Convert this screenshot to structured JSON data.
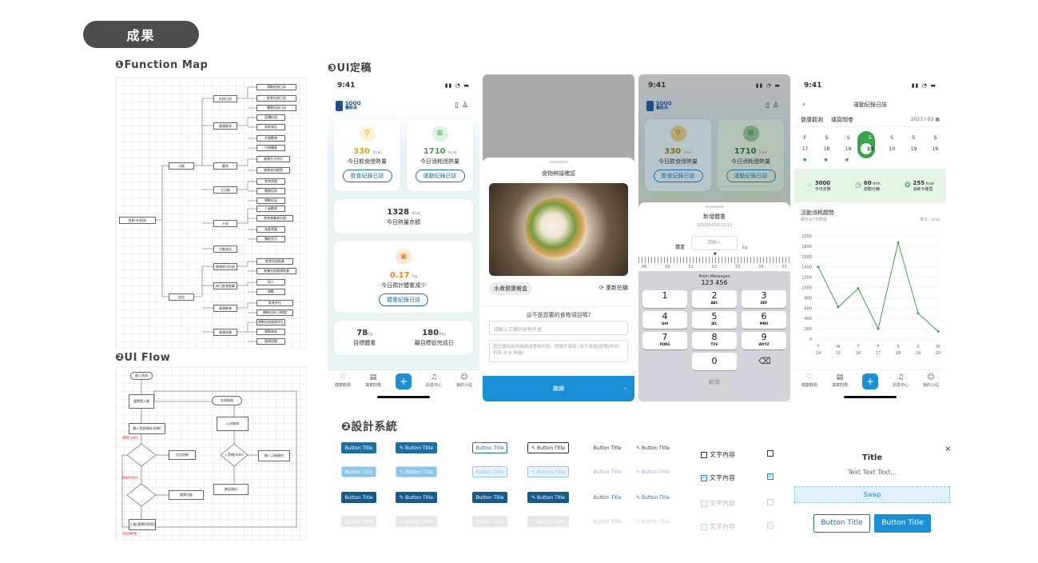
{
  "header_pill": "成果",
  "sections": {
    "function_map": "❶Function Map",
    "ui_flow": "❷UI Flow",
    "ui_final": "❸UI定稿",
    "design_system": "❷設計系統"
  },
  "fm": {
    "root": "首頁(未登錄)",
    "l1": [
      "功能",
      "設定"
    ],
    "l2": [
      "紀錄日誌",
      "健康觀測",
      "簡易",
      "主功能",
      "分享",
      "活動資訊",
      "健康狀況紀錄",
      "每日飲食推薦",
      "健康數據",
      "健康提醒"
    ],
    "l3": [
      "運動紀錄日誌",
      "飲食紀錄日誌",
      "體重紀錄日誌",
      "身體紀錄",
      "調查報告",
      "步驟數據",
      "目標體重",
      "健康生活評估",
      "健康資訊觀察",
      "食物辨識",
      "體重紀錄",
      "運動紀錄",
      "人員數據",
      "食物營養資料檔",
      "減重建議",
      "體能狀況",
      "飲食紀錄推薦",
      "營養紀錄健康推薦",
      "個人",
      "總數",
      "飲食評估",
      "運動紀錄(已歸檔)",
      "運動紀錄健康評估",
      "運動檢查",
      "健康提醒",
      "運動時間提醒",
      "飲食提醒"
    ]
  },
  "flow": {
    "nodes": [
      "進入首頁",
      "選擇登入鍵",
      "輸入登錄資料(密碼)",
      "忘記密碼",
      "選擇功能",
      "註冊帳號",
      "公式檢視",
      "輸入密碼(Admin)",
      "輸入正確資料",
      "確認資料",
      "登入後(選擇回到首頁)",
      "錯誤登入(提示)",
      "錯誤資料(提示)",
      "忘記密碼流程",
      "前往首頁-登入"
    ]
  },
  "phones": {
    "p1": {
      "time": "9:41",
      "brand": "SOQQ",
      "brand_sub": "醫股派",
      "kcal_in": "330",
      "kcal_out": "1710",
      "unit": "kcal",
      "in_label": "今日飲食總熱量",
      "out_label": "今日消耗總熱量",
      "in_btn": "飲食紀錄日誌",
      "out_btn": "運動紀錄日誌",
      "gap": "1328",
      "gap_label": "今日熱量赤額",
      "loss": "0.17",
      "loss_unit": "kg",
      "loss_label": "今日預計體重減少",
      "weight_btn": "體重紀錄日誌",
      "target": "78",
      "target_unit": "kg",
      "target_label": "目標體重",
      "days": "180",
      "days_unit": "day",
      "days_label": "離目標從完成日",
      "tabs": [
        "健康觀測",
        "填寫問卷",
        "",
        "訊息中心",
        "我的小站"
      ]
    },
    "p2": {
      "title": "食物辨識確認",
      "food": "水煮健康餐盒",
      "retake": "重新拍攝",
      "q": "這不是您要的食物項目嗎?",
      "input_ph": "請輸入正確的食物名稱",
      "desc_ph": "請您盡可能詳細描述食物內容，閱讀字填寫,(英文或建)區隔(例如：奶茶,去冰,無糖)",
      "btn": "繼續"
    },
    "p3": {
      "time": "9:41",
      "title": "新增體重",
      "date": "2023/04/16 12:15",
      "field": "體重",
      "ph": "請輸入",
      "unit": "kg",
      "ruler": [
        "49",
        "50",
        "51",
        "52",
        "53",
        "54",
        "55"
      ],
      "msg1": "From Messages",
      "msg2": "123 456",
      "keys": [
        [
          "1",
          ""
        ],
        [
          "2",
          "ABC"
        ],
        [
          "3",
          "DEF"
        ],
        [
          "4",
          "GHI"
        ],
        [
          "5",
          "JKL"
        ],
        [
          "6",
          "MNO"
        ],
        [
          "7",
          "PQRS"
        ],
        [
          "8",
          "TUV"
        ],
        [
          "9",
          "WXYZ"
        ]
      ],
      "zero": "0",
      "back": "⌫",
      "add": "新增"
    },
    "p4": {
      "time": "9:41",
      "title": "運動紀錄日誌",
      "tabs": [
        "健康觀測",
        "填寫問卷",
        "",
        "訊息中心",
        "我的小站"
      ],
      "month": "2023 / 03",
      "week_a": [
        "F",
        "S",
        "S",
        "S",
        "S",
        "S",
        "S"
      ],
      "week_b": [
        "17",
        "18",
        "19",
        "19",
        "10",
        "19",
        "19"
      ],
      "stat1": "3000",
      "stat1_l": "今日步數",
      "stat2": "60",
      "stat2_u": "min",
      "stat2_l": "運動分鐘",
      "stat3": "255",
      "stat3_u": "kcal",
      "stat3_l": "消耗卡路里",
      "chart_title": "活動消耗趨勢",
      "chart_sub": "顯示近7日數據",
      "chart_unit": "單位：kcal",
      "yticks": [
        "2000",
        "1800",
        "1600",
        "1400",
        "1200",
        "1000",
        "800",
        "600",
        "400",
        "200",
        "0"
      ],
      "xtop": [
        "T",
        "W",
        "T",
        "F",
        "S",
        "S",
        "M"
      ],
      "xbot": [
        "14",
        "15",
        "16",
        "17",
        "18",
        "19",
        "20"
      ]
    }
  },
  "chart_data": {
    "type": "line",
    "categories": [
      "T 14",
      "W 15",
      "T 16",
      "F 17",
      "S 18",
      "S 19",
      "M 20"
    ],
    "values": [
      1400,
      620,
      980,
      200,
      1870,
      500,
      150
    ],
    "ylim": [
      0,
      2000
    ],
    "xlabel": "",
    "ylabel": ""
  },
  "ds": {
    "btn": "Button Title",
    "cb": "文字內容",
    "modal_title": "Title",
    "modal_text": "Text Text Text...",
    "swap": "Swap",
    "btn_a": "Button Title",
    "btn_b": "Button Title",
    "close": "×"
  }
}
